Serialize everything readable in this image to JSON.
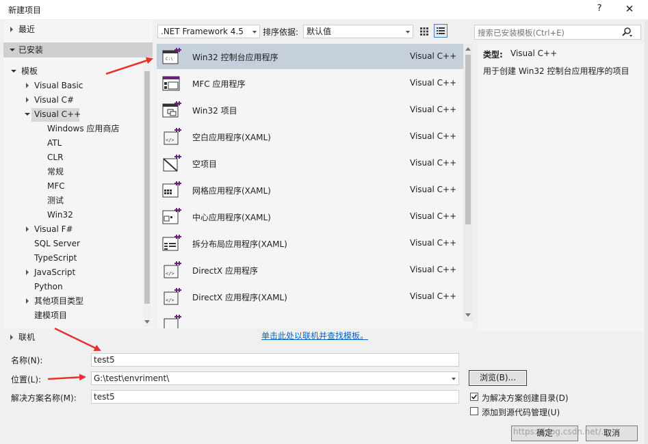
{
  "window": {
    "title": "新建项目",
    "help": "?",
    "close": "✕"
  },
  "nav": {
    "recent": "最近",
    "installed": "已安装",
    "templates": "模板",
    "items": [
      {
        "label": "Visual Basic"
      },
      {
        "label": "Visual C#"
      },
      {
        "label": "Visual C++"
      },
      {
        "label": "Windows 应用商店"
      },
      {
        "label": "ATL"
      },
      {
        "label": "CLR"
      },
      {
        "label": "常规"
      },
      {
        "label": "MFC"
      },
      {
        "label": "测试"
      },
      {
        "label": "Win32"
      },
      {
        "label": "Visual F#"
      },
      {
        "label": "SQL Server"
      },
      {
        "label": "TypeScript"
      },
      {
        "label": "JavaScript"
      },
      {
        "label": "Python"
      },
      {
        "label": "其他项目类型"
      },
      {
        "label": "建模项目"
      }
    ],
    "online": "联机"
  },
  "toolbar": {
    "framework": ".NET Framework 4.5",
    "sort_label": "排序依据:",
    "sort_value": "默认值",
    "search_placeholder": "搜索已安装模板(Ctrl+E)"
  },
  "templates": [
    {
      "name": "Win32 控制台应用程序",
      "lang": "Visual C++"
    },
    {
      "name": "MFC 应用程序",
      "lang": "Visual C++"
    },
    {
      "name": "Win32 项目",
      "lang": "Visual C++"
    },
    {
      "name": "空白应用程序(XAML)",
      "lang": "Visual C++"
    },
    {
      "name": "空项目",
      "lang": "Visual C++"
    },
    {
      "name": "网格应用程序(XAML)",
      "lang": "Visual C++"
    },
    {
      "name": "中心应用程序(XAML)",
      "lang": "Visual C++"
    },
    {
      "name": "拆分布局应用程序(XAML)",
      "lang": "Visual C++"
    },
    {
      "name": "DirectX 应用程序",
      "lang": "Visual C++"
    },
    {
      "name": "DirectX 应用程序(XAML)",
      "lang": "Visual C++"
    }
  ],
  "online_link": "单击此处以联机并查找模板。",
  "detail": {
    "type_label": "类型:",
    "type_value": "Visual C++",
    "description": "用于创建 Win32 控制台应用程序的项目"
  },
  "form": {
    "name_label": "名称(N):",
    "name_value": "test5",
    "location_label": "位置(L):",
    "location_value": "G:\\test\\envriment\\",
    "solution_label": "解决方案名称(M):",
    "solution_value": "test5",
    "browse": "浏览(B)...",
    "create_dir": "为解决方案创建目录(D)",
    "create_dir_checked": true,
    "add_source_control": "添加到源代码管理(U)",
    "add_source_control_checked": false,
    "ok": "确定",
    "cancel": "取消"
  },
  "watermark": "https://blog.csdn.net/...",
  "colors": {
    "selection": "#c6d0dd",
    "link": "#0066cc",
    "arrow": "#e8312a"
  }
}
